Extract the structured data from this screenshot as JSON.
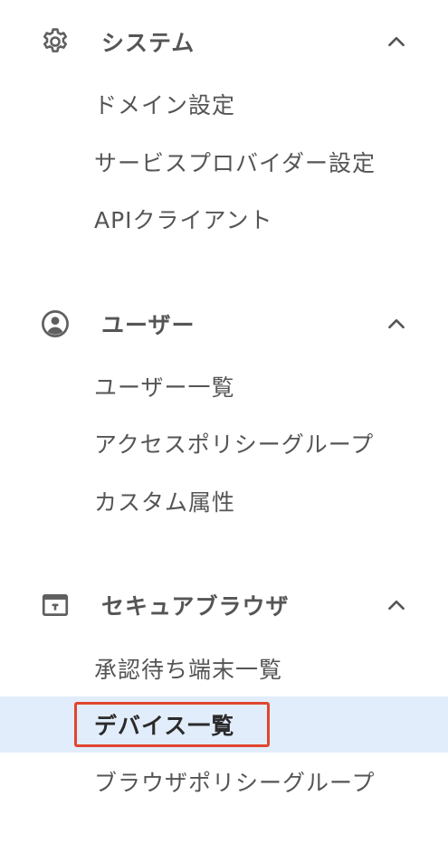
{
  "sections": [
    {
      "title": "システム",
      "icon": "gear-icon",
      "expanded": true,
      "items": [
        {
          "label": "ドメイン設定"
        },
        {
          "label": "サービスプロバイダー設定"
        },
        {
          "label": "APIクライアント"
        }
      ]
    },
    {
      "title": "ユーザー",
      "icon": "account-circle-icon",
      "expanded": true,
      "items": [
        {
          "label": "ユーザー一覧"
        },
        {
          "label": "アクセスポリシーグループ"
        },
        {
          "label": "カスタム属性"
        }
      ]
    },
    {
      "title": "セキュアブラウザ",
      "icon": "browser-window-icon",
      "expanded": true,
      "items": [
        {
          "label": "承認待ち端末一覧"
        },
        {
          "label": "デバイス一覧",
          "selected": true
        },
        {
          "label": "ブラウザポリシーグループ"
        }
      ]
    }
  ],
  "colors": {
    "text": "#555555",
    "selected_bg": "#e2edfb",
    "highlight_border": "#e0462e"
  }
}
